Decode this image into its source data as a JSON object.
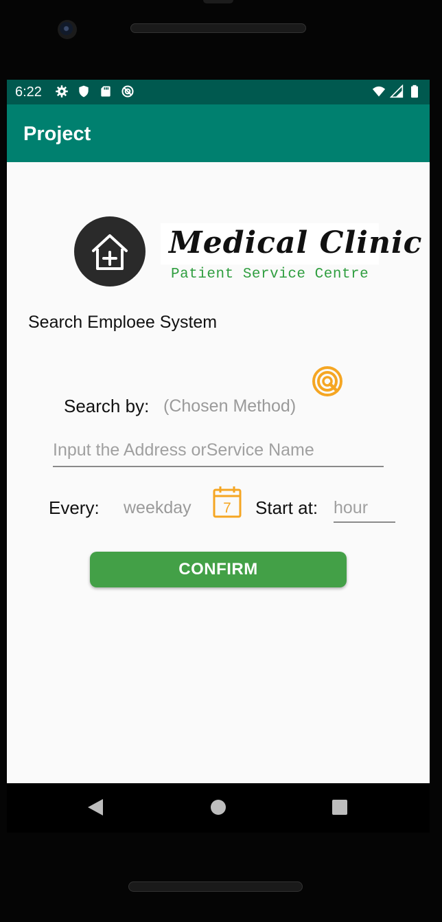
{
  "status_bar": {
    "time": "6:22",
    "left_icons": [
      "settings-icon",
      "shield-icon",
      "sd-card-icon",
      "sync-icon"
    ],
    "right_icons": [
      "wifi-icon",
      "signal-icon",
      "battery-icon"
    ]
  },
  "app_bar": {
    "title": "Project",
    "color": "#00806f",
    "status_color": "#00594f"
  },
  "brand": {
    "logo_icon": "home-plus-icon",
    "title": "Medical Clinic",
    "subtitle": "Patient Service Centre"
  },
  "content": {
    "system_title": "Search Emploee System",
    "search_by_label": "Search by:",
    "search_by_value": "(Chosen Method)",
    "search_icon": "search-target-icon",
    "address_placeholder": "Input the Address orService Name",
    "every_label": "Every:",
    "weekday_value": "weekday",
    "calendar_icon": "calendar-icon",
    "calendar_day": "7",
    "start_label": "Start at:",
    "hour_placeholder": "hour",
    "confirm_label": "CONFIRM",
    "confirm_color": "#43a047",
    "accent_icon_color": "#f5a623"
  },
  "nav_bar": {
    "buttons": [
      "back-icon",
      "home-icon",
      "recents-icon"
    ]
  }
}
